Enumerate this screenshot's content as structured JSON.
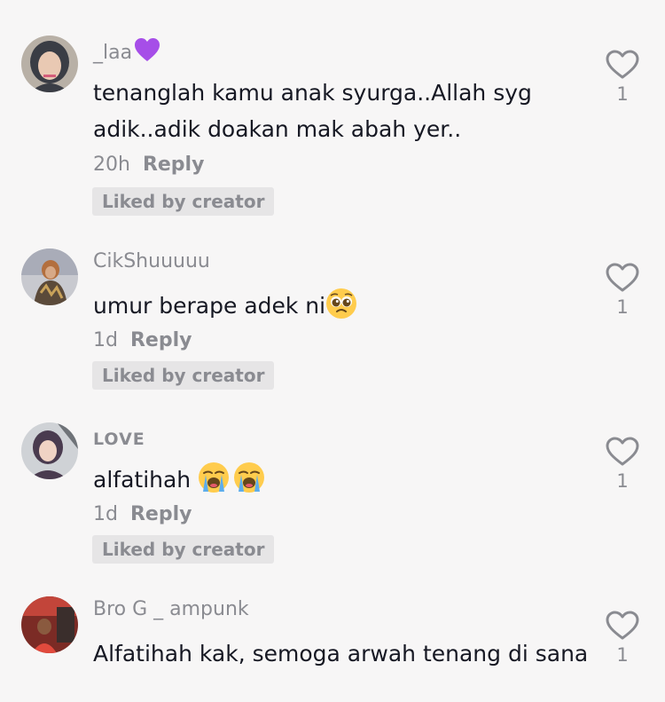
{
  "comments": [
    {
      "username": "_laa",
      "username_emoji": "purple-heart-icon",
      "text": "tenanglah kamu anak syurga..Allah syg adik..adik doakan mak abah yer..",
      "time": "20h",
      "reply_label": "Reply",
      "badge": "Liked by creator",
      "likes": "1"
    },
    {
      "username": "CikShuuuuu",
      "text": "umur berape adek ni",
      "text_emoji": "pleading-face-icon",
      "time": "1d",
      "reply_label": "Reply",
      "badge": "Liked by creator",
      "likes": "1"
    },
    {
      "username": "LOVE",
      "text": "alfatihah ",
      "text_emoji": "loudly-crying-face-icon",
      "time": "1d",
      "reply_label": "Reply",
      "badge": "Liked by creator",
      "likes": "1"
    },
    {
      "username": "Bro G _ ampunk",
      "text": "Alfatihah kak, semoga arwah tenang di sana",
      "likes": "1"
    }
  ],
  "colors": {
    "background": "#f7f6f6",
    "primary_text": "#161823",
    "secondary_text": "#8a8b91",
    "badge_background": "#e6e5e6",
    "purple_heart": "#a64ee8"
  }
}
